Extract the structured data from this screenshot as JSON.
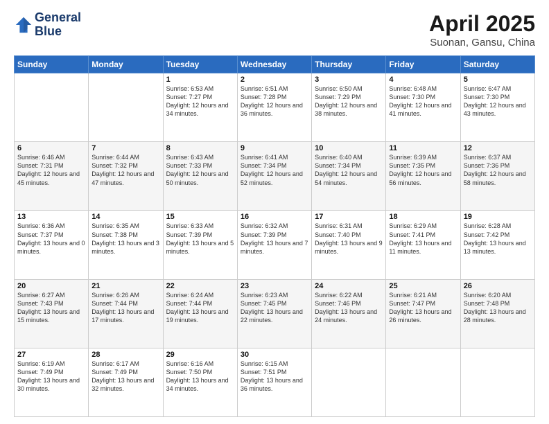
{
  "header": {
    "logo_line1": "General",
    "logo_line2": "Blue",
    "title": "April 2025",
    "subtitle": "Suonan, Gansu, China"
  },
  "weekdays": [
    "Sunday",
    "Monday",
    "Tuesday",
    "Wednesday",
    "Thursday",
    "Friday",
    "Saturday"
  ],
  "weeks": [
    [
      {
        "day": "",
        "info": ""
      },
      {
        "day": "",
        "info": ""
      },
      {
        "day": "1",
        "info": "Sunrise: 6:53 AM\nSunset: 7:27 PM\nDaylight: 12 hours and 34 minutes."
      },
      {
        "day": "2",
        "info": "Sunrise: 6:51 AM\nSunset: 7:28 PM\nDaylight: 12 hours and 36 minutes."
      },
      {
        "day": "3",
        "info": "Sunrise: 6:50 AM\nSunset: 7:29 PM\nDaylight: 12 hours and 38 minutes."
      },
      {
        "day": "4",
        "info": "Sunrise: 6:48 AM\nSunset: 7:30 PM\nDaylight: 12 hours and 41 minutes."
      },
      {
        "day": "5",
        "info": "Sunrise: 6:47 AM\nSunset: 7:30 PM\nDaylight: 12 hours and 43 minutes."
      }
    ],
    [
      {
        "day": "6",
        "info": "Sunrise: 6:46 AM\nSunset: 7:31 PM\nDaylight: 12 hours and 45 minutes."
      },
      {
        "day": "7",
        "info": "Sunrise: 6:44 AM\nSunset: 7:32 PM\nDaylight: 12 hours and 47 minutes."
      },
      {
        "day": "8",
        "info": "Sunrise: 6:43 AM\nSunset: 7:33 PM\nDaylight: 12 hours and 50 minutes."
      },
      {
        "day": "9",
        "info": "Sunrise: 6:41 AM\nSunset: 7:34 PM\nDaylight: 12 hours and 52 minutes."
      },
      {
        "day": "10",
        "info": "Sunrise: 6:40 AM\nSunset: 7:34 PM\nDaylight: 12 hours and 54 minutes."
      },
      {
        "day": "11",
        "info": "Sunrise: 6:39 AM\nSunset: 7:35 PM\nDaylight: 12 hours and 56 minutes."
      },
      {
        "day": "12",
        "info": "Sunrise: 6:37 AM\nSunset: 7:36 PM\nDaylight: 12 hours and 58 minutes."
      }
    ],
    [
      {
        "day": "13",
        "info": "Sunrise: 6:36 AM\nSunset: 7:37 PM\nDaylight: 13 hours and 0 minutes."
      },
      {
        "day": "14",
        "info": "Sunrise: 6:35 AM\nSunset: 7:38 PM\nDaylight: 13 hours and 3 minutes."
      },
      {
        "day": "15",
        "info": "Sunrise: 6:33 AM\nSunset: 7:39 PM\nDaylight: 13 hours and 5 minutes."
      },
      {
        "day": "16",
        "info": "Sunrise: 6:32 AM\nSunset: 7:39 PM\nDaylight: 13 hours and 7 minutes."
      },
      {
        "day": "17",
        "info": "Sunrise: 6:31 AM\nSunset: 7:40 PM\nDaylight: 13 hours and 9 minutes."
      },
      {
        "day": "18",
        "info": "Sunrise: 6:29 AM\nSunset: 7:41 PM\nDaylight: 13 hours and 11 minutes."
      },
      {
        "day": "19",
        "info": "Sunrise: 6:28 AM\nSunset: 7:42 PM\nDaylight: 13 hours and 13 minutes."
      }
    ],
    [
      {
        "day": "20",
        "info": "Sunrise: 6:27 AM\nSunset: 7:43 PM\nDaylight: 13 hours and 15 minutes."
      },
      {
        "day": "21",
        "info": "Sunrise: 6:26 AM\nSunset: 7:44 PM\nDaylight: 13 hours and 17 minutes."
      },
      {
        "day": "22",
        "info": "Sunrise: 6:24 AM\nSunset: 7:44 PM\nDaylight: 13 hours and 19 minutes."
      },
      {
        "day": "23",
        "info": "Sunrise: 6:23 AM\nSunset: 7:45 PM\nDaylight: 13 hours and 22 minutes."
      },
      {
        "day": "24",
        "info": "Sunrise: 6:22 AM\nSunset: 7:46 PM\nDaylight: 13 hours and 24 minutes."
      },
      {
        "day": "25",
        "info": "Sunrise: 6:21 AM\nSunset: 7:47 PM\nDaylight: 13 hours and 26 minutes."
      },
      {
        "day": "26",
        "info": "Sunrise: 6:20 AM\nSunset: 7:48 PM\nDaylight: 13 hours and 28 minutes."
      }
    ],
    [
      {
        "day": "27",
        "info": "Sunrise: 6:19 AM\nSunset: 7:49 PM\nDaylight: 13 hours and 30 minutes."
      },
      {
        "day": "28",
        "info": "Sunrise: 6:17 AM\nSunset: 7:49 PM\nDaylight: 13 hours and 32 minutes."
      },
      {
        "day": "29",
        "info": "Sunrise: 6:16 AM\nSunset: 7:50 PM\nDaylight: 13 hours and 34 minutes."
      },
      {
        "day": "30",
        "info": "Sunrise: 6:15 AM\nSunset: 7:51 PM\nDaylight: 13 hours and 36 minutes."
      },
      {
        "day": "",
        "info": ""
      },
      {
        "day": "",
        "info": ""
      },
      {
        "day": "",
        "info": ""
      }
    ]
  ]
}
